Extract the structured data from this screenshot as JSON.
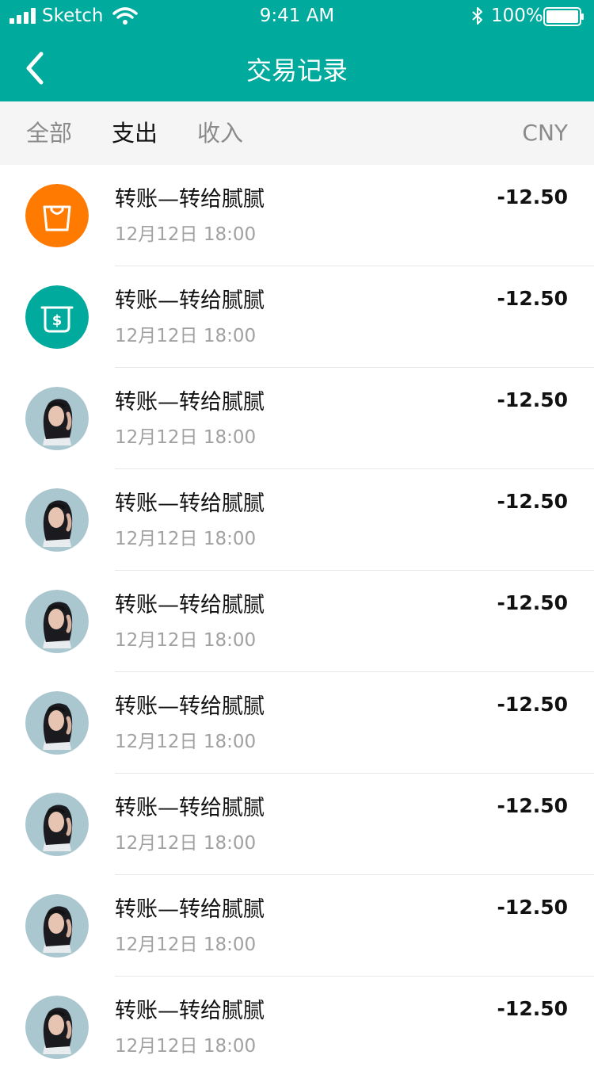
{
  "status_bar": {
    "carrier": "Sketch",
    "time": "9:41 AM",
    "battery": "100%"
  },
  "header": {
    "title": "交易记录",
    "background_color": "#00ab9d"
  },
  "tabs": {
    "items": [
      {
        "label": "全部"
      },
      {
        "label": "支出"
      },
      {
        "label": "收入"
      }
    ],
    "selected": "支出",
    "currency": "CNY"
  },
  "transactions": [
    {
      "icon": "shopping-bag-icon",
      "icon_color": "#ff7a00",
      "title": "转账—转给腻腻",
      "date": "12月12日 18:00",
      "amount": "-12.50"
    },
    {
      "icon": "atm-dollar-icon",
      "icon_color": "#00ab9d",
      "title": "转账—转给腻腻",
      "date": "12月12日 18:00",
      "amount": "-12.50"
    },
    {
      "icon": "user-avatar",
      "title": "转账—转给腻腻",
      "date": "12月12日 18:00",
      "amount": "-12.50"
    },
    {
      "icon": "user-avatar",
      "title": "转账—转给腻腻",
      "date": "12月12日 18:00",
      "amount": "-12.50"
    },
    {
      "icon": "user-avatar",
      "title": "转账—转给腻腻",
      "date": "12月12日 18:00",
      "amount": "-12.50"
    },
    {
      "icon": "user-avatar",
      "title": "转账—转给腻腻",
      "date": "12月12日 18:00",
      "amount": "-12.50"
    },
    {
      "icon": "user-avatar",
      "title": "转账—转给腻腻",
      "date": "12月12日 18:00",
      "amount": "-12.50"
    },
    {
      "icon": "user-avatar",
      "title": "转账—转给腻腻",
      "date": "12月12日 18:00",
      "amount": "-12.50"
    },
    {
      "icon": "user-avatar",
      "title": "转账—转给腻腻",
      "date": "12月12日 18:00",
      "amount": "-12.50"
    }
  ]
}
